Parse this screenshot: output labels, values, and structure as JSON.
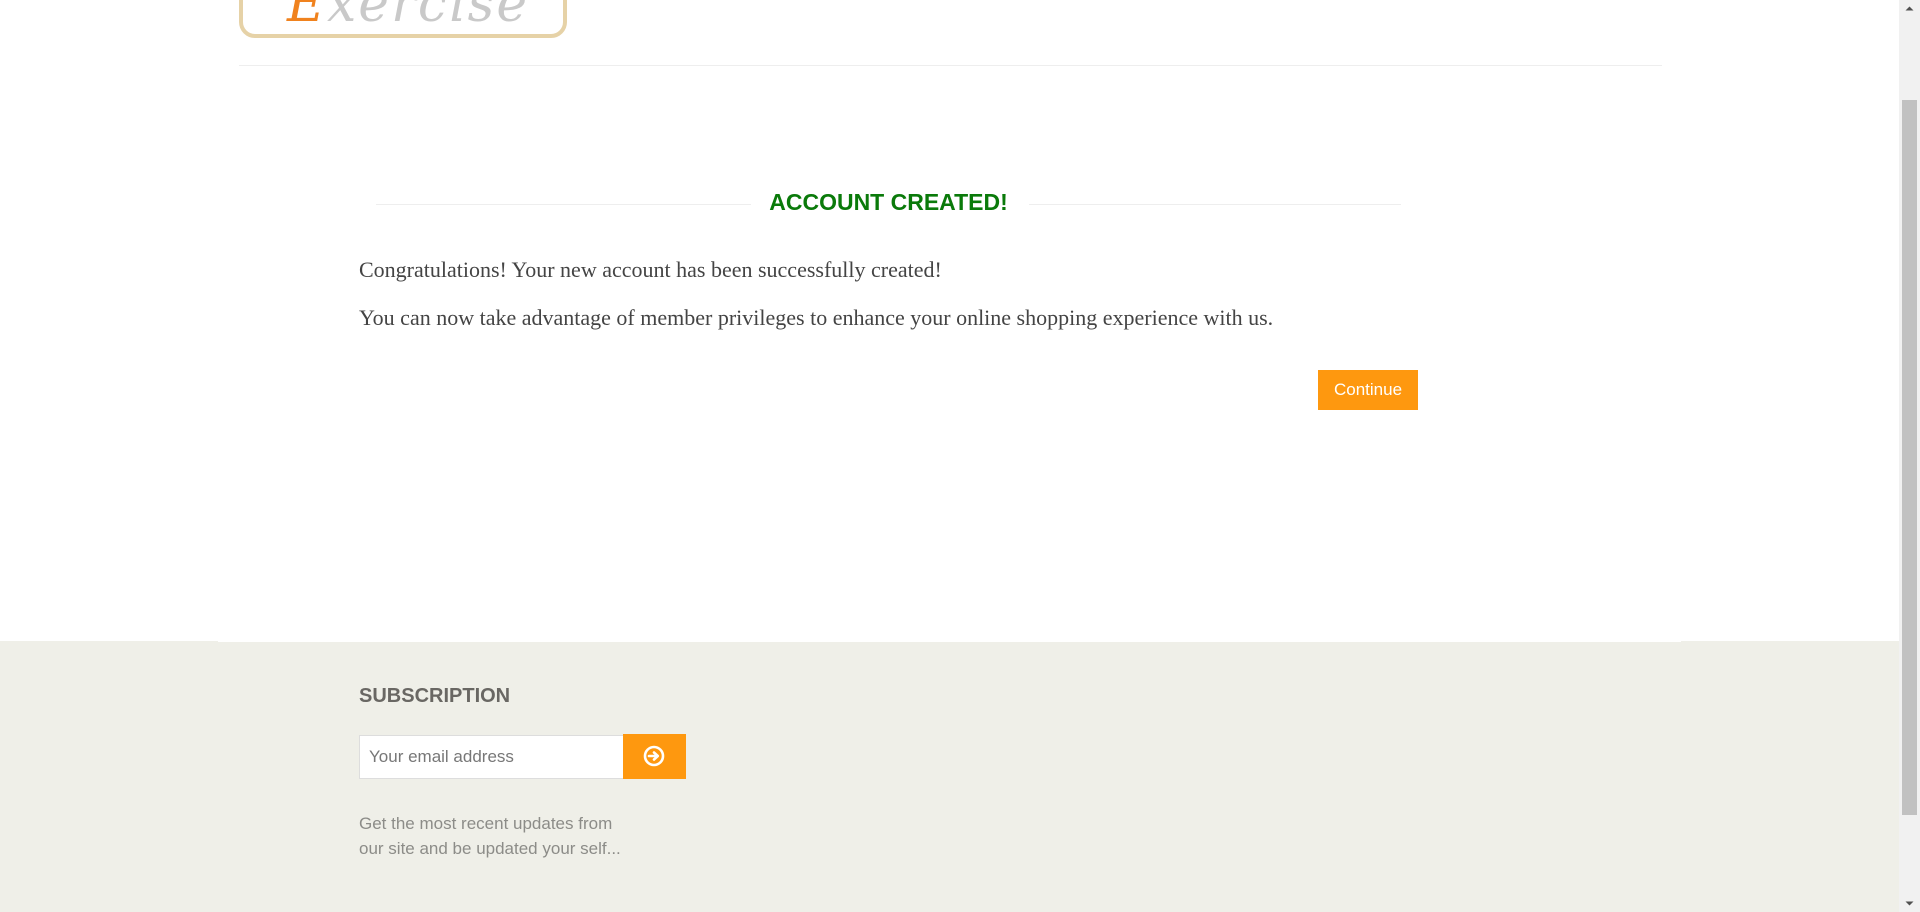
{
  "header": {
    "logo": {
      "text_first": "E",
      "text_rest": "xercise"
    }
  },
  "main": {
    "title": "ACCOUNT CREATED!",
    "message_1": "Congratulations! Your new account has been successfully created!",
    "message_2": "You can now take advantage of member privileges to enhance your online shopping experience with us.",
    "continue_label": "Continue"
  },
  "footer": {
    "subscription": {
      "title": "SUBSCRIPTION",
      "email_placeholder": "Your email address",
      "email_value": "",
      "button_icon": "arrow-circle-right-icon",
      "description_line_1": "Get the most recent updates from",
      "description_line_2": "our site and be updated your self..."
    }
  },
  "colors": {
    "accent": "#fe980f",
    "title_green": "#0a7a0a",
    "footer_bg": "#efefe8",
    "logo_border": "#e6d2a7"
  }
}
